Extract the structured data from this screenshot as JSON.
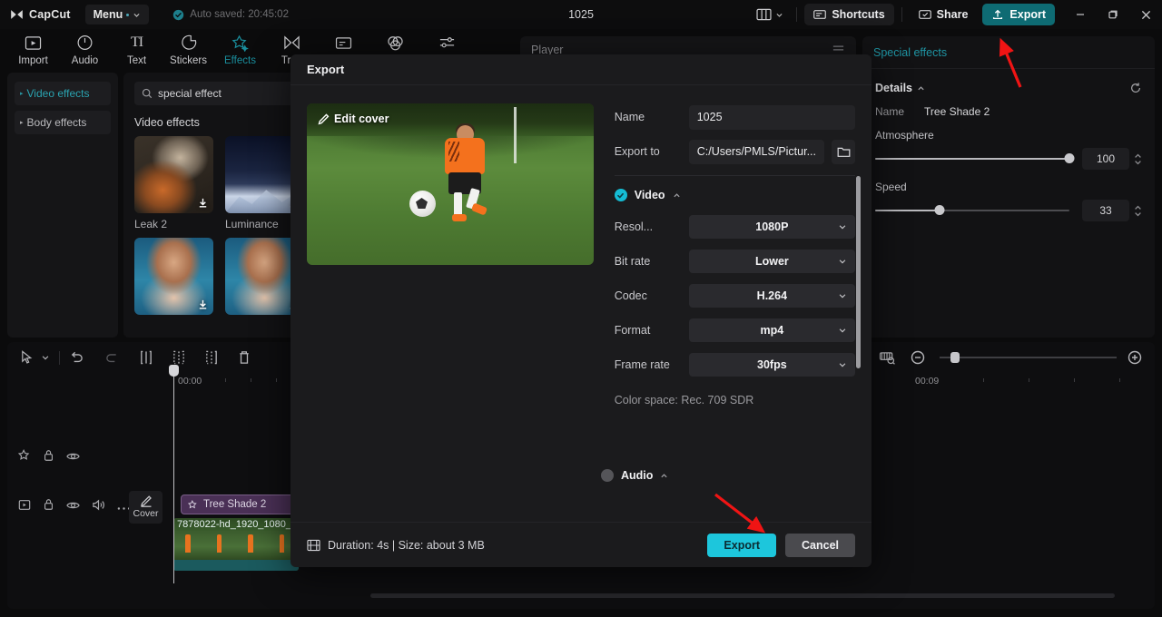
{
  "titlebar": {
    "brand": "CapCut",
    "menu_label": "Menu",
    "autosave_text": "Auto saved: 20:45:02",
    "project_title": "1025",
    "shortcuts_label": "Shortcuts",
    "share_label": "Share",
    "export_label": "Export",
    "icons": {
      "logo": "capcut-logo-icon",
      "autosave": "check-circle-icon",
      "layout": "layout-icon",
      "shortcuts": "keyboard-icon",
      "share": "share-icon",
      "export": "upload-icon",
      "minimize": "minimize-icon",
      "maximize": "restore-icon",
      "close": "close-icon"
    }
  },
  "tooltabs": [
    {
      "label": "Import",
      "icon": "import-icon",
      "active": false
    },
    {
      "label": "Audio",
      "icon": "audio-icon",
      "active": false
    },
    {
      "label": "Text",
      "icon": "text-icon",
      "active": false
    },
    {
      "label": "Stickers",
      "icon": "stickers-icon",
      "active": false
    },
    {
      "label": "Effects",
      "icon": "effects-icon",
      "active": true
    },
    {
      "label": "Tran",
      "icon": "transitions-icon",
      "active": false
    },
    {
      "label": "",
      "icon": "captions-icon",
      "active": false
    },
    {
      "label": "",
      "icon": "filters-icon",
      "active": false
    },
    {
      "label": "",
      "icon": "adjust-icon",
      "active": false
    }
  ],
  "leftnav": {
    "items": [
      {
        "label": "Video effects",
        "active": true
      },
      {
        "label": "Body effects",
        "active": false
      }
    ]
  },
  "effects_panel": {
    "search_value": "special effect",
    "section_title": "Video effects",
    "items": [
      {
        "label": "Leak 2"
      },
      {
        "label": "Luminance"
      },
      {
        "label": ""
      },
      {
        "label": ""
      }
    ]
  },
  "player": {
    "title": "Player"
  },
  "right_panel": {
    "header": "Special effects",
    "details_title": "Details",
    "name_label": "Name",
    "name_value": "Tree Shade 2",
    "sliders": [
      {
        "label": "Atmosphere",
        "value": "100",
        "percent": 100
      },
      {
        "label": "Speed",
        "value": "33",
        "percent": 33
      }
    ]
  },
  "timeline": {
    "toolbar_icons": [
      "select-tool-icon",
      "chevron-down-icon",
      "undo-icon",
      "redo-icon",
      "split-icon",
      "trim-start-icon",
      "trim-end-icon",
      "delete-icon"
    ],
    "right_icons": [
      "magnet-icon",
      "link-icon",
      "mirror-icon",
      "keyframe-icon",
      "zoom-out-icon",
      "zoom-in-icon"
    ],
    "ruler_labels": [
      "00:00",
      "00:09"
    ],
    "effect_clip_label": "Tree Shade 2",
    "video_clip_label": "7878022-hd_1920_1080_",
    "cover_button_label": "Cover",
    "track_head_icons": [
      "effect-icon",
      "lock-icon",
      "eye-icon",
      "play-icon",
      "volume-icon",
      "more-icon"
    ]
  },
  "export_dialog": {
    "title": "Export",
    "edit_cover_label": "Edit cover",
    "fields": {
      "name_label": "Name",
      "name_value": "1025",
      "export_to_label": "Export to",
      "export_to_value": "C:/Users/PMLS/Pictur...",
      "folder_icon": "folder-icon"
    },
    "video_section": {
      "title": "Video",
      "checked": true,
      "rows": [
        {
          "label": "Resol...",
          "value": "1080P"
        },
        {
          "label": "Bit rate",
          "value": "Lower"
        },
        {
          "label": "Codec",
          "value": "H.264"
        },
        {
          "label": "Format",
          "value": "mp4"
        },
        {
          "label": "Frame rate",
          "value": "30fps"
        }
      ],
      "color_space": "Color space: Rec. 709 SDR"
    },
    "audio_section": {
      "title": "Audio",
      "checked": false
    },
    "footer": {
      "duration_text": "Duration: 4s | Size: about 3 MB",
      "export_label": "Export",
      "cancel_label": "Cancel"
    }
  },
  "colors": {
    "accent_teal": "#1dc6dc",
    "brand_green": "#0e6b73",
    "annotation_red": "#f01414",
    "panel_bg": "#121214",
    "dialog_bg": "#1b1b1d"
  }
}
